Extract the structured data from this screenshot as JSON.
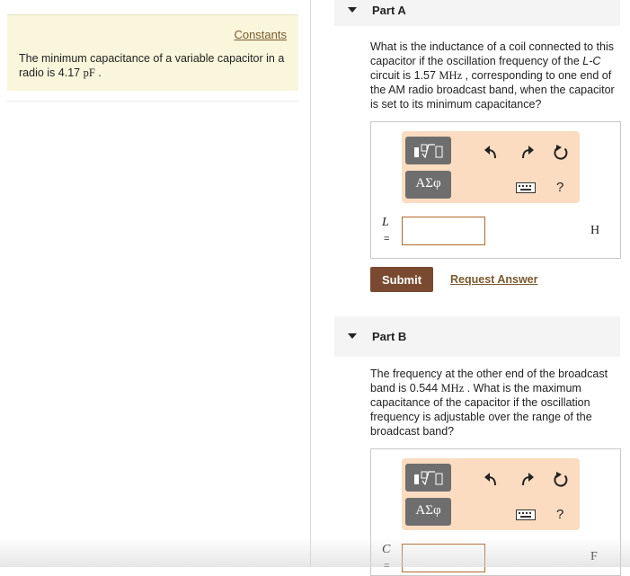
{
  "info": {
    "constants_label": "Constants",
    "text_before": "The minimum capacitance of a variable capacitor in a radio is 4.17 ",
    "unit": "pF",
    "text_after": " ."
  },
  "part_a": {
    "title": "Part A",
    "q1": "What is the inductance of a coil connected to this capacitor if the oscillation frequency of the ",
    "q_lc": "L-C",
    "q2": " circuit is 1.57 ",
    "q_unit": "MHz",
    "q3": " , corresponding to one end of the AM radio broadcast band, when the capacitor is set to its minimum capacitance?",
    "toolbar": {
      "greek_label": "ΑΣφ",
      "help_label": "?"
    },
    "variable": "L",
    "equals": "=",
    "input_value": "",
    "unit": "H",
    "submit_label": "Submit",
    "request_label": "Request Answer"
  },
  "part_b": {
    "title": "Part B",
    "q1": "The frequency at the other end of the broadcast band is 0.544 ",
    "q_unit": "MHz",
    "q2": " . What is the maximum capacitance of the capacitor if the oscillation frequency is adjustable over the range of the broadcast band?",
    "toolbar": {
      "greek_label": "ΑΣφ",
      "help_label": "?"
    },
    "variable": "C",
    "equals": "=",
    "input_value": "",
    "unit": "F"
  },
  "colors": {
    "info_bg": "#faf6dc",
    "toolbar_bg": "#fbdcc0",
    "submit_bg": "#7a4a30",
    "link": "#7a5a2e",
    "input_border": "#b56a2c"
  }
}
